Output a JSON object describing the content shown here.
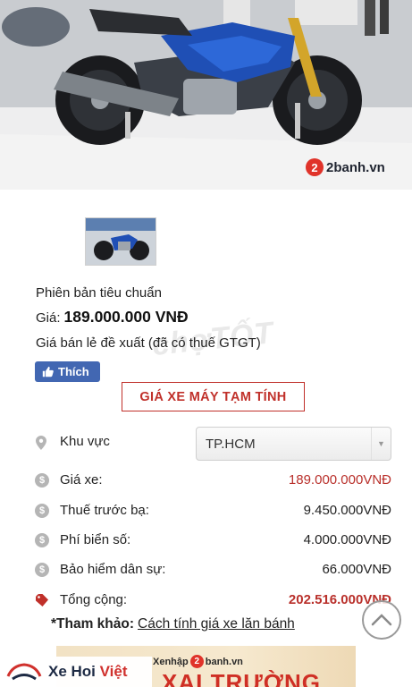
{
  "hero": {
    "watermark_brand": "2banh.vn",
    "watermark_mark": "2"
  },
  "product": {
    "version_label": "Phiên bản tiêu chuẩn",
    "price_label": "Giá:",
    "price_value": "189.000.000 VNĐ",
    "retail_note": "Giá bán lẻ đề xuất (đã có thuế GTGT)",
    "bg_watermark": "chợTỐT"
  },
  "like_button": {
    "label": "Thích",
    "color": "#4267b2"
  },
  "calculator": {
    "title": "GIÁ XE MÁY TẠM TÍNH",
    "accent_color": "#c0302a",
    "region_label": "Khu vực",
    "region_selected": "TP.HCM",
    "rows": [
      {
        "icon": "dollar-icon",
        "label": "Giá xe:",
        "value": "189.000.000VNĐ"
      },
      {
        "icon": "dollar-icon",
        "label": "Thuế trước bạ:",
        "value": "9.450.000VNĐ"
      },
      {
        "icon": "dollar-icon",
        "label": "Phí biển số:",
        "value": "4.000.000VNĐ"
      },
      {
        "icon": "dollar-icon",
        "label": "Bảo hiểm dân sự:",
        "value": "66.000VNĐ"
      },
      {
        "icon": "price-tag-icon",
        "label": "Tổng cộng:",
        "value": "202.516.000VNĐ"
      }
    ],
    "reference_prefix": "*Tham khảo:",
    "reference_link": "Cách tính giá xe lăn bánh"
  },
  "banner": {
    "brand_prefix": "Xenhập",
    "brand_mark": "2",
    "brand_suffix": "banh.vn",
    "headline": "XAI TRƯỜNG"
  },
  "footer": {
    "logo_text": "Xe Hoi",
    "logo_text_accent": "Việt"
  }
}
